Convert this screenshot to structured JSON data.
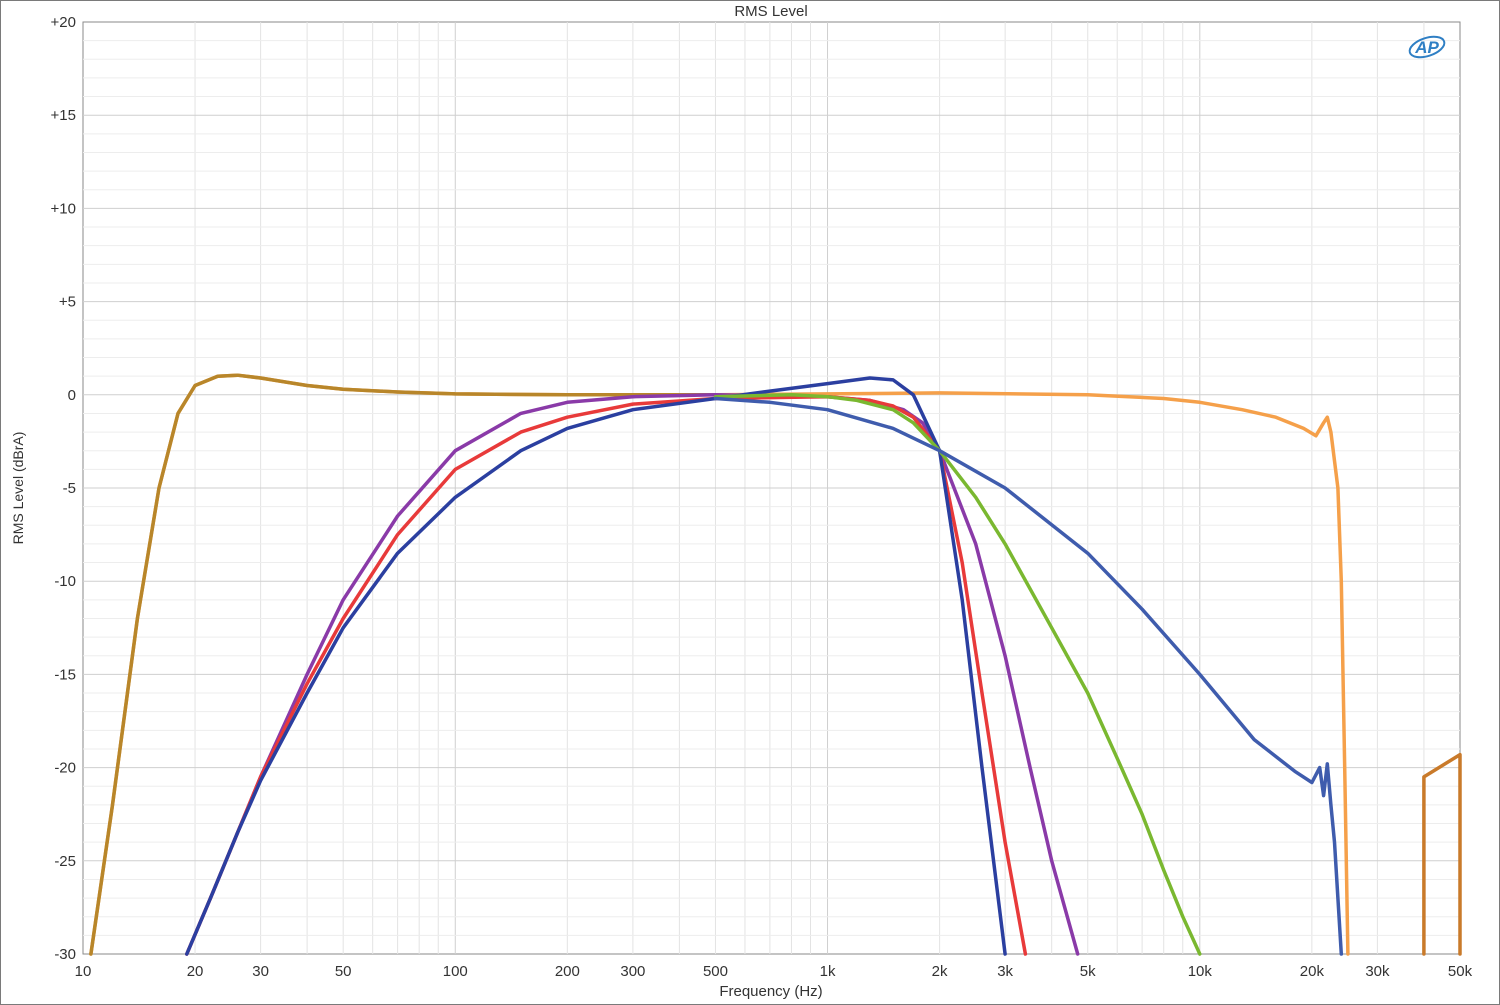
{
  "chart_data": {
    "type": "line",
    "title": "RMS Level",
    "xlabel": "Frequency (Hz)",
    "ylabel": "RMS Level (dBrA)",
    "x_scale": "log",
    "xlim": [
      10,
      50000
    ],
    "ylim": [
      -30,
      20
    ],
    "grid": true,
    "legend": "none",
    "x_ticks": [
      {
        "value": 10,
        "label": "10"
      },
      {
        "value": 20,
        "label": "20"
      },
      {
        "value": 30,
        "label": "30"
      },
      {
        "value": 50,
        "label": "50"
      },
      {
        "value": 100,
        "label": "100"
      },
      {
        "value": 200,
        "label": "200"
      },
      {
        "value": 300,
        "label": "300"
      },
      {
        "value": 500,
        "label": "500"
      },
      {
        "value": 1000,
        "label": "1k"
      },
      {
        "value": 2000,
        "label": "2k"
      },
      {
        "value": 3000,
        "label": "3k"
      },
      {
        "value": 5000,
        "label": "5k"
      },
      {
        "value": 10000,
        "label": "10k"
      },
      {
        "value": 20000,
        "label": "20k"
      },
      {
        "value": 30000,
        "label": "30k"
      },
      {
        "value": 50000,
        "label": "50k"
      }
    ],
    "y_ticks": [
      {
        "value": 20,
        "label": "+20"
      },
      {
        "value": 15,
        "label": "+15"
      },
      {
        "value": 10,
        "label": "+10"
      },
      {
        "value": 5,
        "label": "+5"
      },
      {
        "value": 0,
        "label": "0"
      },
      {
        "value": -5,
        "label": "-5"
      },
      {
        "value": -10,
        "label": "-10"
      },
      {
        "value": -15,
        "label": "-15"
      },
      {
        "value": -20,
        "label": "-20"
      },
      {
        "value": -25,
        "label": "-25"
      },
      {
        "value": -30,
        "label": "-30"
      }
    ],
    "series": [
      {
        "color": "#f5a04a",
        "x": [
          10.5,
          12,
          14,
          16,
          18,
          20,
          23,
          26,
          30,
          40,
          50,
          70,
          100,
          200,
          500,
          1000,
          2000,
          5000,
          8000,
          10000,
          13000,
          16000,
          19000,
          20500,
          21500,
          22000,
          22500,
          23500,
          24000,
          24500,
          25000
        ],
        "y": [
          -30,
          -22,
          -12,
          -5,
          -1,
          0.5,
          1.0,
          1.05,
          0.9,
          0.5,
          0.3,
          0.15,
          0.05,
          0.0,
          0.0,
          0.05,
          0.1,
          0.0,
          -0.2,
          -0.4,
          -0.8,
          -1.2,
          -1.8,
          -2.2,
          -1.5,
          -1.2,
          -2.0,
          -5,
          -10,
          -20,
          -30
        ]
      },
      {
        "color": "#b8862a",
        "x": [
          10.5,
          12,
          14,
          16,
          18,
          20,
          23,
          26,
          30,
          40,
          50,
          70,
          100,
          200,
          500
        ],
        "y": [
          -30,
          -22,
          -12,
          -5,
          -1,
          0.5,
          1.0,
          1.05,
          0.9,
          0.5,
          0.3,
          0.15,
          0.05,
          0.0,
          0.0
        ]
      },
      {
        "color": "#8a3aa8",
        "x": [
          19,
          22,
          26,
          30,
          40,
          50,
          70,
          100,
          150,
          200,
          300,
          500,
          1000,
          1300,
          1600,
          1800,
          2000,
          2500,
          3000,
          3500,
          4000,
          4700
        ],
        "y": [
          -30,
          -27,
          -23.5,
          -20.5,
          -15,
          -11,
          -6.5,
          -3,
          -1,
          -0.4,
          -0.1,
          0.0,
          -0.1,
          -0.3,
          -0.8,
          -1.5,
          -3,
          -8,
          -14,
          -20,
          -25,
          -30
        ]
      },
      {
        "color": "#e83a3a",
        "x": [
          19,
          22,
          26,
          30,
          40,
          50,
          70,
          100,
          150,
          200,
          300,
          500,
          1000,
          1300,
          1500,
          1700,
          2000,
          2300,
          2600,
          3000,
          3400
        ],
        "y": [
          -30,
          -27,
          -23.5,
          -20.5,
          -15.5,
          -12,
          -7.5,
          -4,
          -2,
          -1.2,
          -0.5,
          -0.2,
          -0.1,
          -0.3,
          -0.6,
          -1.2,
          -3,
          -9,
          -16,
          -24,
          -30
        ]
      },
      {
        "color": "#2b3fa0",
        "x": [
          19,
          22,
          26,
          30,
          40,
          50,
          70,
          100,
          150,
          200,
          300,
          500,
          700,
          1000,
          1300,
          1500,
          1700,
          2000,
          2300,
          2600,
          3000
        ],
        "y": [
          -30,
          -27,
          -23.5,
          -20.7,
          -16,
          -12.5,
          -8.5,
          -5.5,
          -3,
          -1.8,
          -0.8,
          -0.2,
          0.2,
          0.6,
          0.9,
          0.8,
          0.0,
          -3,
          -11,
          -20,
          -30
        ]
      },
      {
        "color": "#7ab830",
        "x": [
          500,
          800,
          1000,
          1200,
          1500,
          1700,
          2000,
          2500,
          3000,
          4000,
          5000,
          6000,
          7000,
          8000,
          9000,
          10000
        ],
        "y": [
          -0.1,
          0.0,
          -0.1,
          -0.3,
          -0.8,
          -1.5,
          -3,
          -5.5,
          -8,
          -12.5,
          -16,
          -19.5,
          -22.5,
          -25.5,
          -28,
          -30
        ]
      },
      {
        "color": "#3f5cad",
        "x": [
          500,
          700,
          1000,
          1500,
          2000,
          3000,
          5000,
          7000,
          10000,
          14000,
          18000,
          20000,
          21000,
          21500,
          22000,
          22500,
          23000,
          23500,
          24000
        ],
        "y": [
          -0.2,
          -0.4,
          -0.8,
          -1.8,
          -3,
          -5,
          -8.5,
          -11.5,
          -15,
          -18.5,
          -20.2,
          -20.8,
          -20,
          -21.5,
          -19.8,
          -22,
          -24,
          -27,
          -30
        ]
      },
      {
        "color": "#c97a2a",
        "x": [
          40000,
          40000,
          50000,
          50000
        ],
        "y": [
          -30,
          -20.5,
          -19.3,
          -30
        ]
      }
    ]
  }
}
